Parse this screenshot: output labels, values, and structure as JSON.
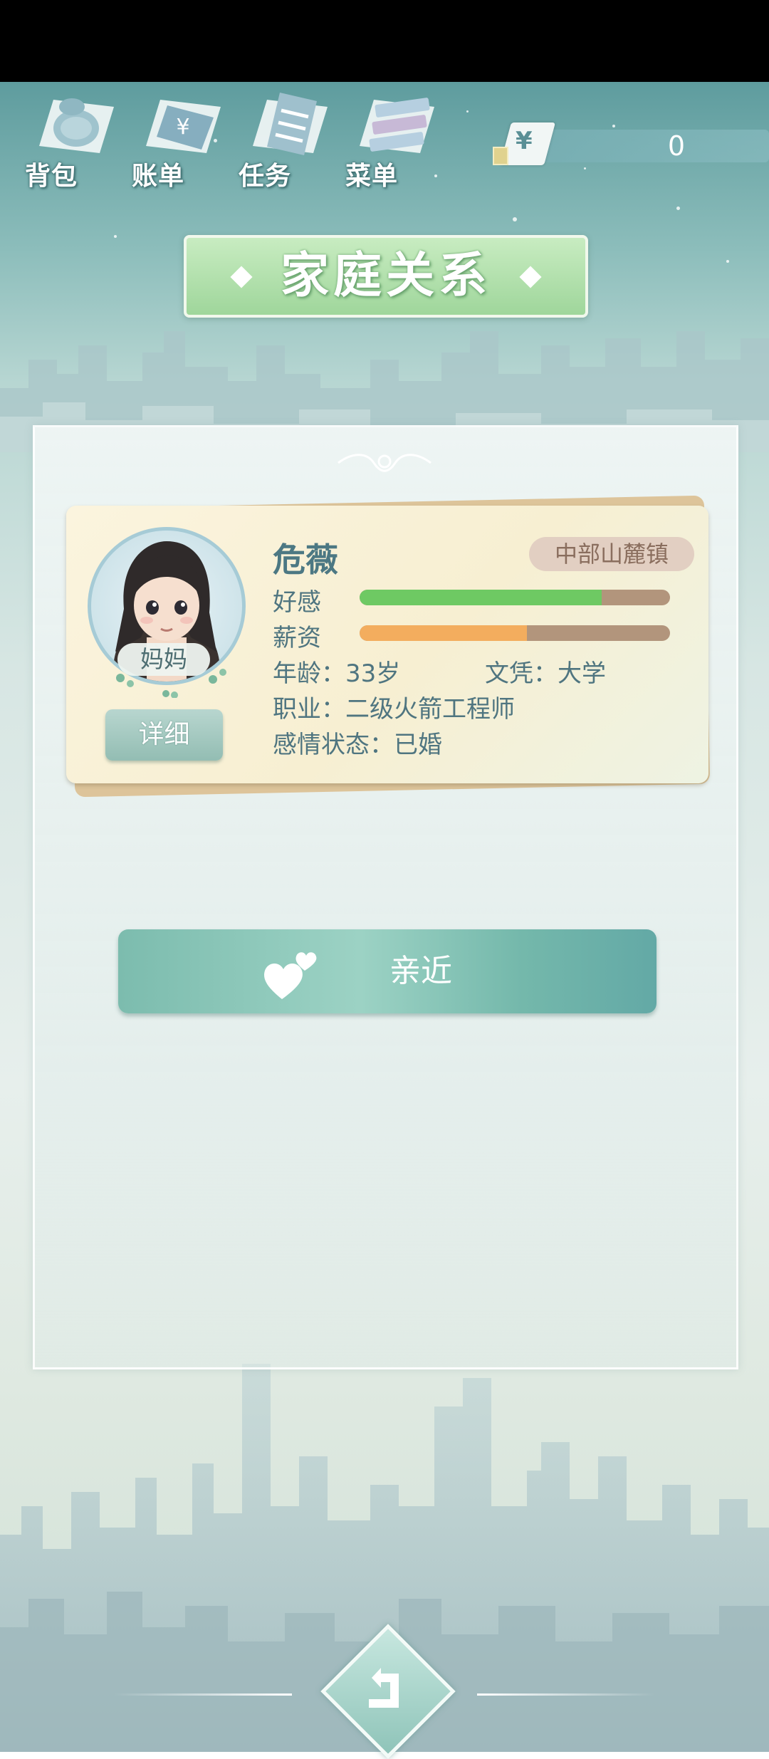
{
  "toolbar": {
    "items": [
      {
        "label": "背包",
        "icon": "bag-icon"
      },
      {
        "label": "账单",
        "icon": "bill-icon"
      },
      {
        "label": "任务",
        "icon": "task-icon"
      },
      {
        "label": "菜单",
        "icon": "menu-icon"
      }
    ]
  },
  "currency": {
    "symbol": "¥",
    "value": "0"
  },
  "title": "家庭关系",
  "member": {
    "name": "危薇",
    "relation": "妈妈",
    "location": "中部山麓镇",
    "favor_label": "好感",
    "favor_level": 0.78,
    "salary_label": "薪资",
    "salary_level": 0.54,
    "age": "年龄：33岁",
    "education": "文凭：大学",
    "job": "职业：二级火箭工程师",
    "relationship": "感情状态：已婚",
    "detail_button": "详细"
  },
  "actions": {
    "approach": "亲近"
  },
  "colors": {
    "favor": "#6ec963",
    "salary": "#f3ad5e",
    "bar_bg": "#b2957c",
    "title_bg": "#a8dca3"
  }
}
